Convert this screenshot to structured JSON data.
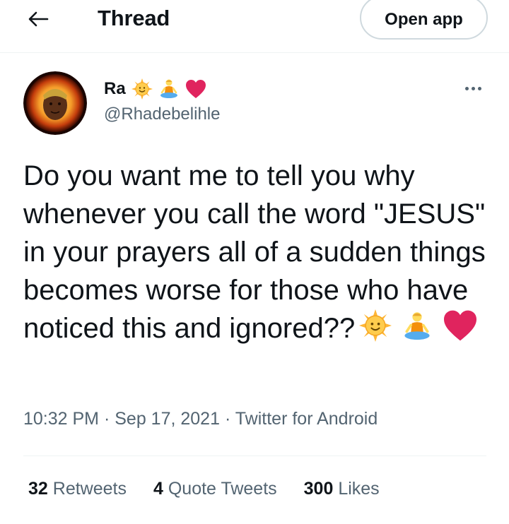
{
  "header": {
    "title": "Thread",
    "open_app_label": "Open app"
  },
  "tweet": {
    "display_name": "Ra",
    "name_emojis": [
      "sun-with-face",
      "person-in-lotus-position",
      "red-heart"
    ],
    "handle": "@Rhadebelihle",
    "text": "Do you want me to tell you why whenever you call the word \"JESUS\" in your prayers all of a sudden things becomes worse for those who have noticed this and ignored??",
    "text_emojis": [
      "sun-with-face",
      "person-in-lotus-position",
      "red-heart"
    ],
    "time": "10:32 PM",
    "date": "Sep 17, 2021",
    "source": "Twitter for Android",
    "separator": "·"
  },
  "stats": {
    "retweets_count": "32",
    "retweets_label": "Retweets",
    "quotes_count": "4",
    "quotes_label": "Quote Tweets",
    "likes_count": "300",
    "likes_label": "Likes"
  },
  "colors": {
    "text_primary": "#0f1419",
    "text_secondary": "#536471",
    "border": "#cfd9de",
    "divider": "#eff3f4",
    "heart": "#e0245e",
    "sun": "#ffb636"
  }
}
